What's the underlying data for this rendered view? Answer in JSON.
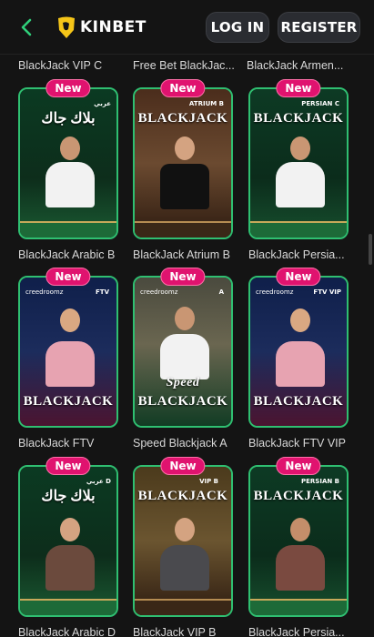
{
  "header": {
    "brand": "KINBET",
    "login_label": "LOG IN",
    "register_label": "REGISTER"
  },
  "top_labels": [
    "BlackJack VIP C",
    "Free Bet BlackJac...",
    "BlackJack Armen..."
  ],
  "badge_label": "New",
  "tiles": [
    {
      "title": "بلاك جاك",
      "tag": "عربي",
      "label": "BlackJack Arabic B"
    },
    {
      "title": "BLACKJACK",
      "tag": "ATRIUM B",
      "label": "BlackJack Atrium B"
    },
    {
      "title": "BLACKJACK",
      "tag": "PERSIAN C",
      "label": "BlackJack Persia..."
    },
    {
      "title": "BLACKJACK",
      "tag": "FTV",
      "brand": "creedroomz",
      "label": "BlackJack FTV"
    },
    {
      "title": "BLACKJACK",
      "tag": "A",
      "brand": "creedroomz",
      "extra": "Speed",
      "label": "Speed Blackjack A"
    },
    {
      "title": "BLACKJACK",
      "tag": "FTV VIP",
      "brand": "creedroomz",
      "label": "BlackJack FTV VIP"
    },
    {
      "title": "بلاك جاك",
      "tag": "عربي D",
      "label": "BlackJack Arabic D"
    },
    {
      "title": "BLACKJACK",
      "tag": "VIP B",
      "label": "BlackJack VIP B"
    },
    {
      "title": "BLACKJACK",
      "tag": "PERSIAN B",
      "label": "BlackJack Persia..."
    }
  ],
  "colors": {
    "background": "#141414",
    "badge": "#e0136f",
    "card_border": "#2fbf71"
  }
}
